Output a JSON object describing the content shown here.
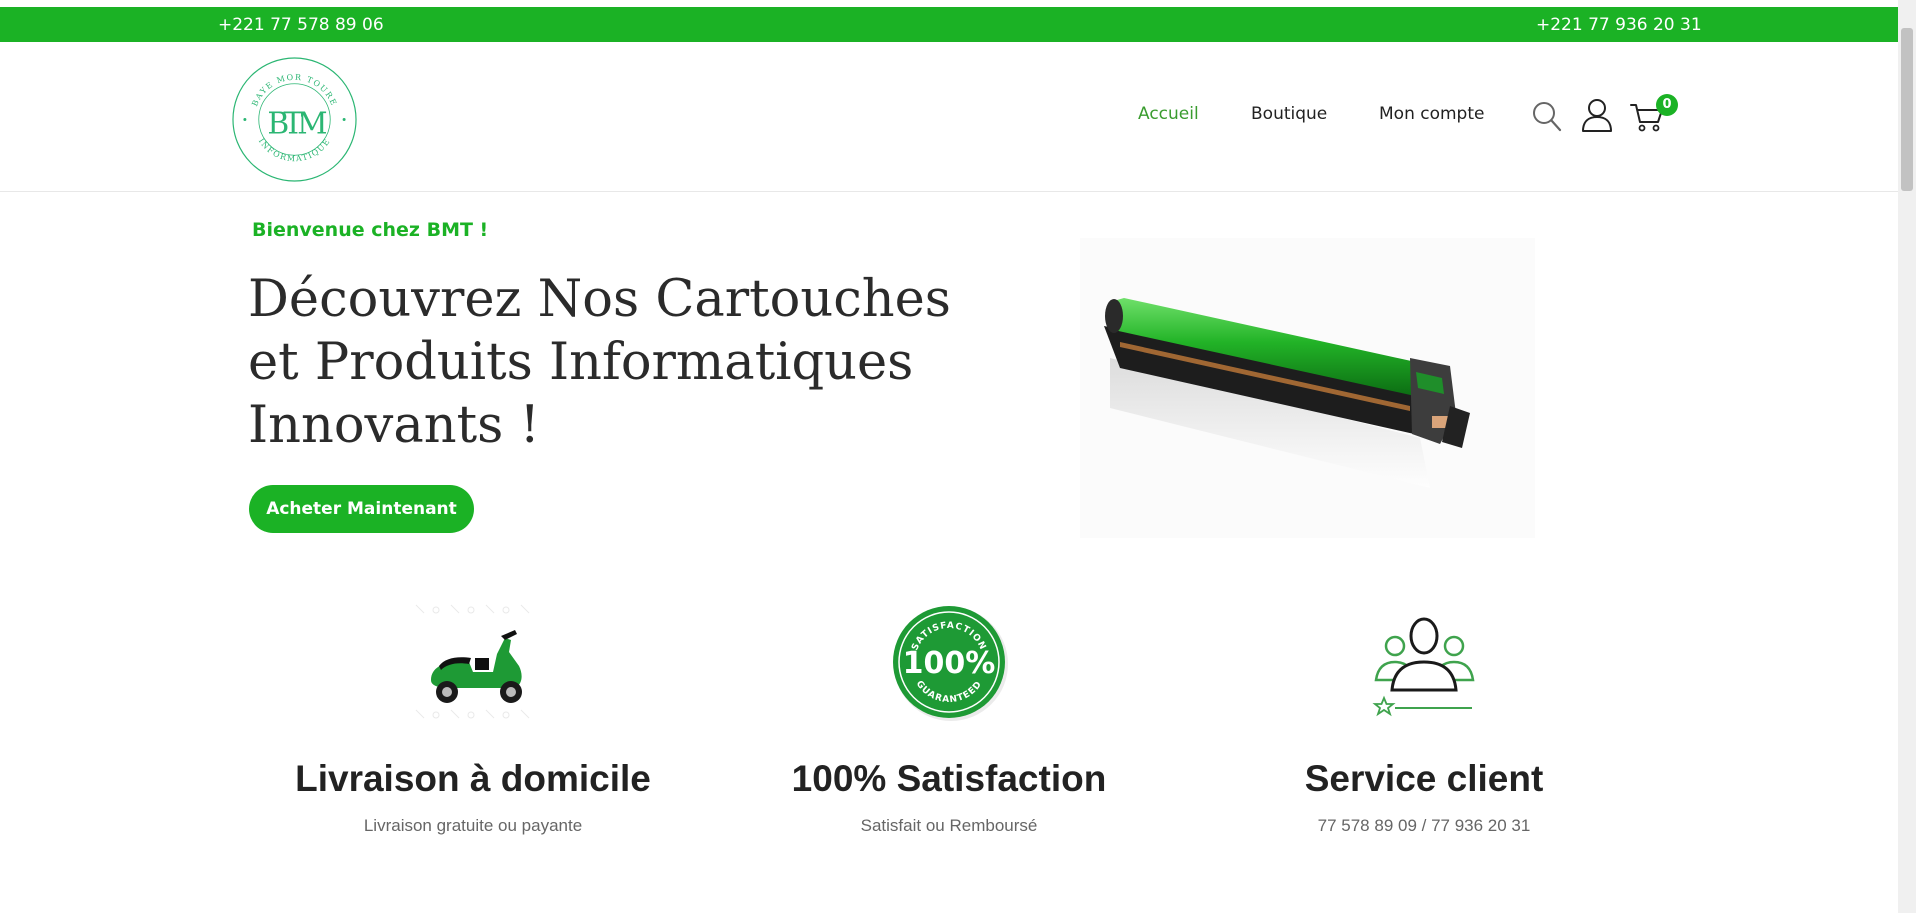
{
  "topbar": {
    "phone_left": "+221 77 578 89 06",
    "phone_right": "+221 77 936 20 31",
    "bg_color": "#1bb225"
  },
  "logo": {
    "monogram": "BTM",
    "ring_text_top": "BAYE MOR TOURE",
    "ring_text_bottom": "INFORMATIQUE",
    "color": "#2bb673"
  },
  "nav": {
    "items": [
      {
        "label": "Accueil",
        "active": true
      },
      {
        "label": "Boutique",
        "active": false
      },
      {
        "label": "Mon compte",
        "active": false
      }
    ],
    "icons": [
      "search-icon",
      "user-icon",
      "cart-icon"
    ],
    "cart_count": "0"
  },
  "hero": {
    "welcome": "Bienvenue chez BMT !",
    "title": "Découvrez Nos Cartouches et Produits Informatiques Innovants !",
    "cta_label": "Acheter Maintenant",
    "image": "printer-drum-cartridge"
  },
  "features": [
    {
      "icon": "scooter-delivery-icon",
      "title": "Livraison à domicile",
      "subtitle": "Livraison gratuite ou payante"
    },
    {
      "icon": "satisfaction-badge-icon",
      "title": "100% Satisfaction",
      "subtitle": "Satisfait ou Remboursé",
      "badge_text_top": "SATISFACTION",
      "badge_number": "100%",
      "badge_text_bottom": "GUARANTEED"
    },
    {
      "icon": "customer-service-icon",
      "title": "Service client",
      "subtitle": "77 578 89 09 / 77 936 20 31"
    }
  ],
  "colors": {
    "accent": "#1bb225",
    "nav_active": "#3a9c2f",
    "text_dark": "#222222",
    "text_muted": "#666666"
  }
}
